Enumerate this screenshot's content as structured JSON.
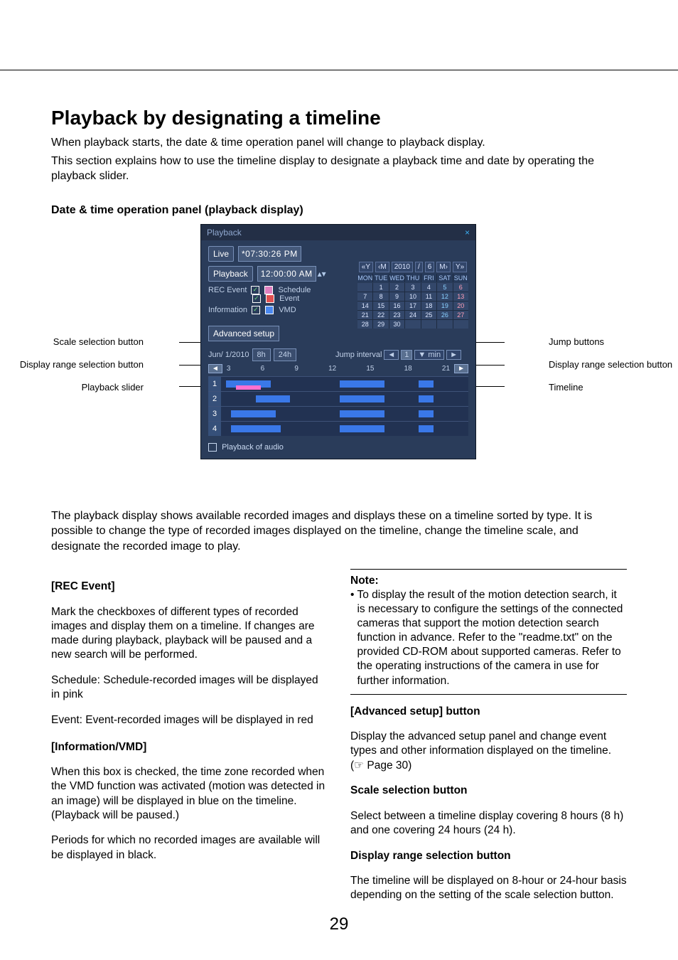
{
  "page_number": "29",
  "title": "Playback by designating a timeline",
  "intro1": "When playback starts, the date & time operation panel will change to playback display.",
  "intro2": "This section explains how to use the timeline display to designate a playback time and date by operating the playback slider.",
  "subhead": "Date & time operation panel (playback display)",
  "panel": {
    "header": "Playback",
    "close": "×",
    "live_btn": "Live",
    "live_time": "*07:30:26 PM",
    "playback_btn": "Playback",
    "playback_time": "12:00:00 AM",
    "rec_event_label": "REC Event",
    "schedule_label": "Schedule",
    "event_label": "Event",
    "information_label": "Information",
    "vmd_label": "VMD",
    "advanced_btn": "Advanced setup",
    "date_label": "Jun/ 1/2010",
    "scale_8h": "8h",
    "scale_24h": "24h",
    "jump_label": "Jump interval",
    "jump_value": "1",
    "jump_unit": "min",
    "ticks": [
      "3",
      "6",
      "9",
      "12",
      "15",
      "18",
      "21"
    ],
    "audio_label": "Playback of audio",
    "cal": {
      "year": "2010",
      "month": "6",
      "prev_y": "«Y",
      "prev_m": "‹M",
      "next_m": "M›",
      "next_y": "Y»",
      "days": [
        "MON",
        "TUE",
        "WED",
        "THU",
        "FRI",
        "SAT",
        "SUN"
      ],
      "cells": [
        "",
        "1",
        "2",
        "3",
        "4",
        "5",
        "6",
        "7",
        "8",
        "9",
        "10",
        "11",
        "12",
        "13",
        "14",
        "15",
        "16",
        "17",
        "18",
        "19",
        "20",
        "21",
        "22",
        "23",
        "24",
        "25",
        "26",
        "27",
        "28",
        "29",
        "30",
        "",
        "",
        "",
        ""
      ]
    }
  },
  "callouts": {
    "left1": "Scale selection button",
    "left2": "Display range selection button",
    "left3": "Playback slider",
    "right1": "Jump buttons",
    "right2": "Display range selection button",
    "right3": "Timeline"
  },
  "after_panel": "The playback display shows available recorded images and displays these on a timeline sorted by type. It is possible to change the type of recorded images displayed on the timeline, change the timeline scale, and designate the recorded image to play.",
  "leftcol": {
    "h1": "[REC Event]",
    "p1": "Mark the checkboxes of different types of recorded images and display them on a timeline. If changes are made during playback, playback will be paused and a new search will be performed.",
    "p2": "Schedule: Schedule-recorded images will be displayed in pink",
    "p3": "Event: Event-recorded images will be displayed in red",
    "h2": "[Information/VMD]",
    "p4": "When this box is checked, the time zone recorded when the VMD function was activated (motion was detected in an image) will be displayed in blue on the timeline. (Playback will be paused.)",
    "p5": "Periods for which no recorded images are available will be displayed in black."
  },
  "rightcol": {
    "note_h": "Note:",
    "note_b": "To display the result of the motion detection search, it is necessary to configure the settings of the connected cameras that support the motion detection search function in advance. Refer to the \"readme.txt\" on the provided CD-ROM about supported cameras. Refer to the operating instructions of the camera in use for further information.",
    "h1": "[Advanced setup] button",
    "p1": "Display the advanced setup panel and change event types and other information displayed on the timeline. (☞ Page 30)",
    "h2": "Scale selection button",
    "p2": "Select between a timeline display covering 8 hours (8 h) and one covering 24 hours (24 h).",
    "h3": "Display range selection button",
    "p3": "The timeline will be displayed on 8-hour or 24-hour basis depending on the setting of the scale selection button."
  }
}
